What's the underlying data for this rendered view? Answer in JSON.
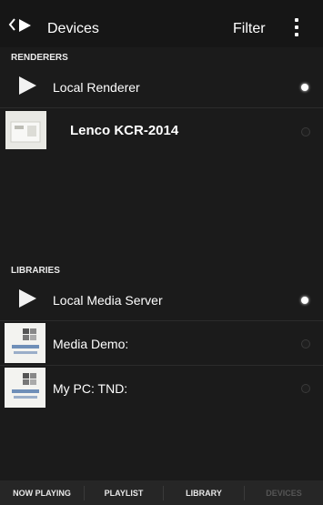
{
  "header": {
    "title": "Devices",
    "filter_label": "Filter"
  },
  "renderers": {
    "section_label": "RENDERERS",
    "items": [
      {
        "label": "Local Renderer",
        "selected": true
      },
      {
        "label": "Lenco KCR-2014",
        "selected": false
      }
    ]
  },
  "libraries": {
    "section_label": "LIBRARIES",
    "items": [
      {
        "label": "Local Media Server",
        "selected": true
      },
      {
        "label": "Media Demo:",
        "selected": false
      },
      {
        "label": "My PC:  TND:",
        "selected": false
      }
    ]
  },
  "tabs": [
    {
      "label": "NOW PLAYING",
      "active": true
    },
    {
      "label": "PLAYLIST",
      "active": true
    },
    {
      "label": "LIBRARY",
      "active": true
    },
    {
      "label": "DEVICES",
      "active": false
    }
  ],
  "icons": {
    "back": "chevron-left-icon",
    "app": "play-icon",
    "menu": "overflow-menu-icon",
    "renderer": "play-icon",
    "device_thumb": "speaker-thumbnail-icon",
    "server": "play-icon",
    "windows_server": "windows-media-icon"
  },
  "colors": {
    "background": "#1b1b1b",
    "topbar": "#161616",
    "bottombar": "#262626",
    "text": "#ffffff",
    "disabled_tab": "#555555"
  }
}
